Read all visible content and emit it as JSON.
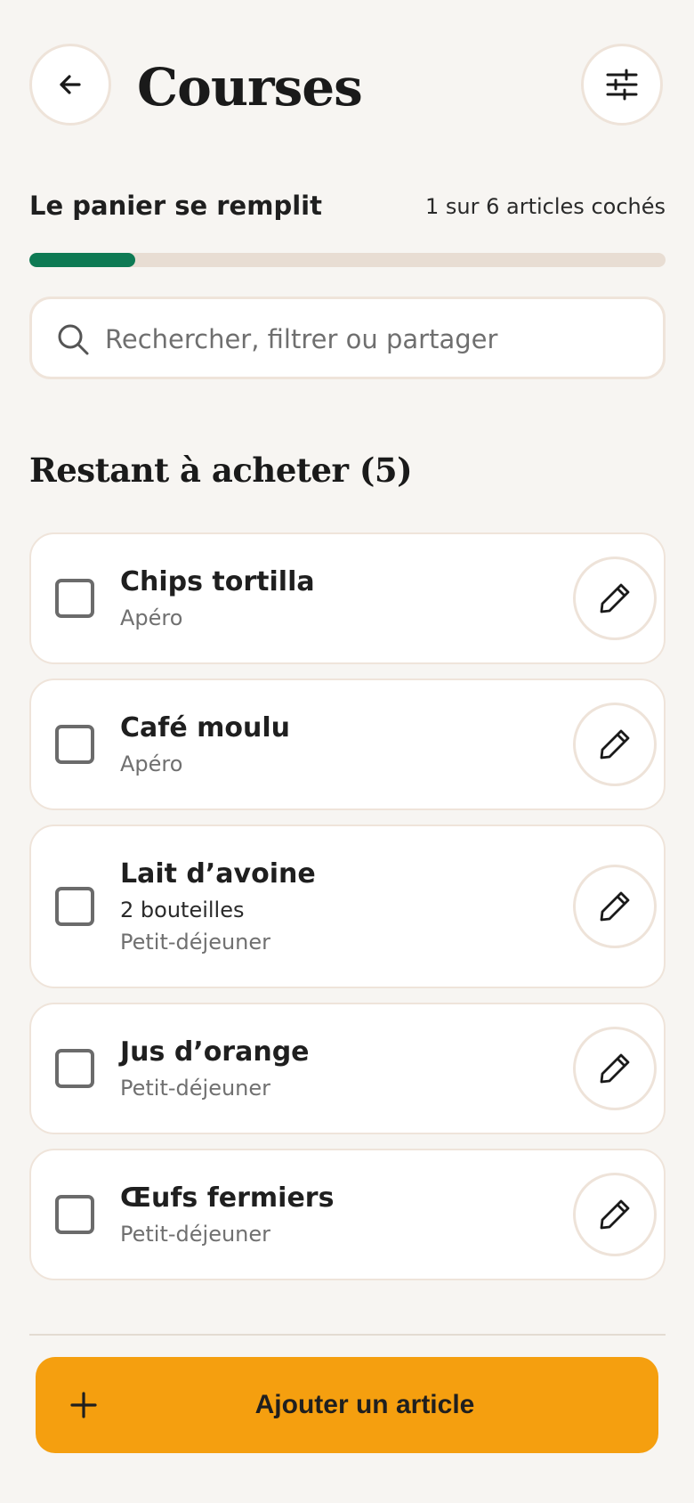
{
  "header": {
    "title": "Courses",
    "back_icon": "arrow-left-icon",
    "filter_icon": "sliders-icon"
  },
  "progress": {
    "label": "Le panier se remplit",
    "count_text": "1 sur 6 articles cochés",
    "fraction": 0.167,
    "color": "#0e7a54"
  },
  "search": {
    "value": "",
    "placeholder": "Rechercher, filtrer ou partager"
  },
  "section": {
    "title": "Restant à acheter (5)"
  },
  "items": [
    {
      "name": "Chips tortilla",
      "quantity": "",
      "category": "Apéro",
      "checked": false
    },
    {
      "name": "Café moulu",
      "quantity": "",
      "category": "Apéro",
      "checked": false
    },
    {
      "name": "Lait d’avoine",
      "quantity": "2 bouteilles",
      "category": "Petit-déjeuner",
      "checked": false
    },
    {
      "name": "Jus d’orange",
      "quantity": "",
      "category": "Petit-déjeuner",
      "checked": false
    },
    {
      "name": "Œufs fermiers",
      "quantity": "",
      "category": "Petit-déjeuner",
      "checked": false
    }
  ],
  "footer": {
    "add_label": "Ajouter un article",
    "accent": "#f59f0f"
  }
}
